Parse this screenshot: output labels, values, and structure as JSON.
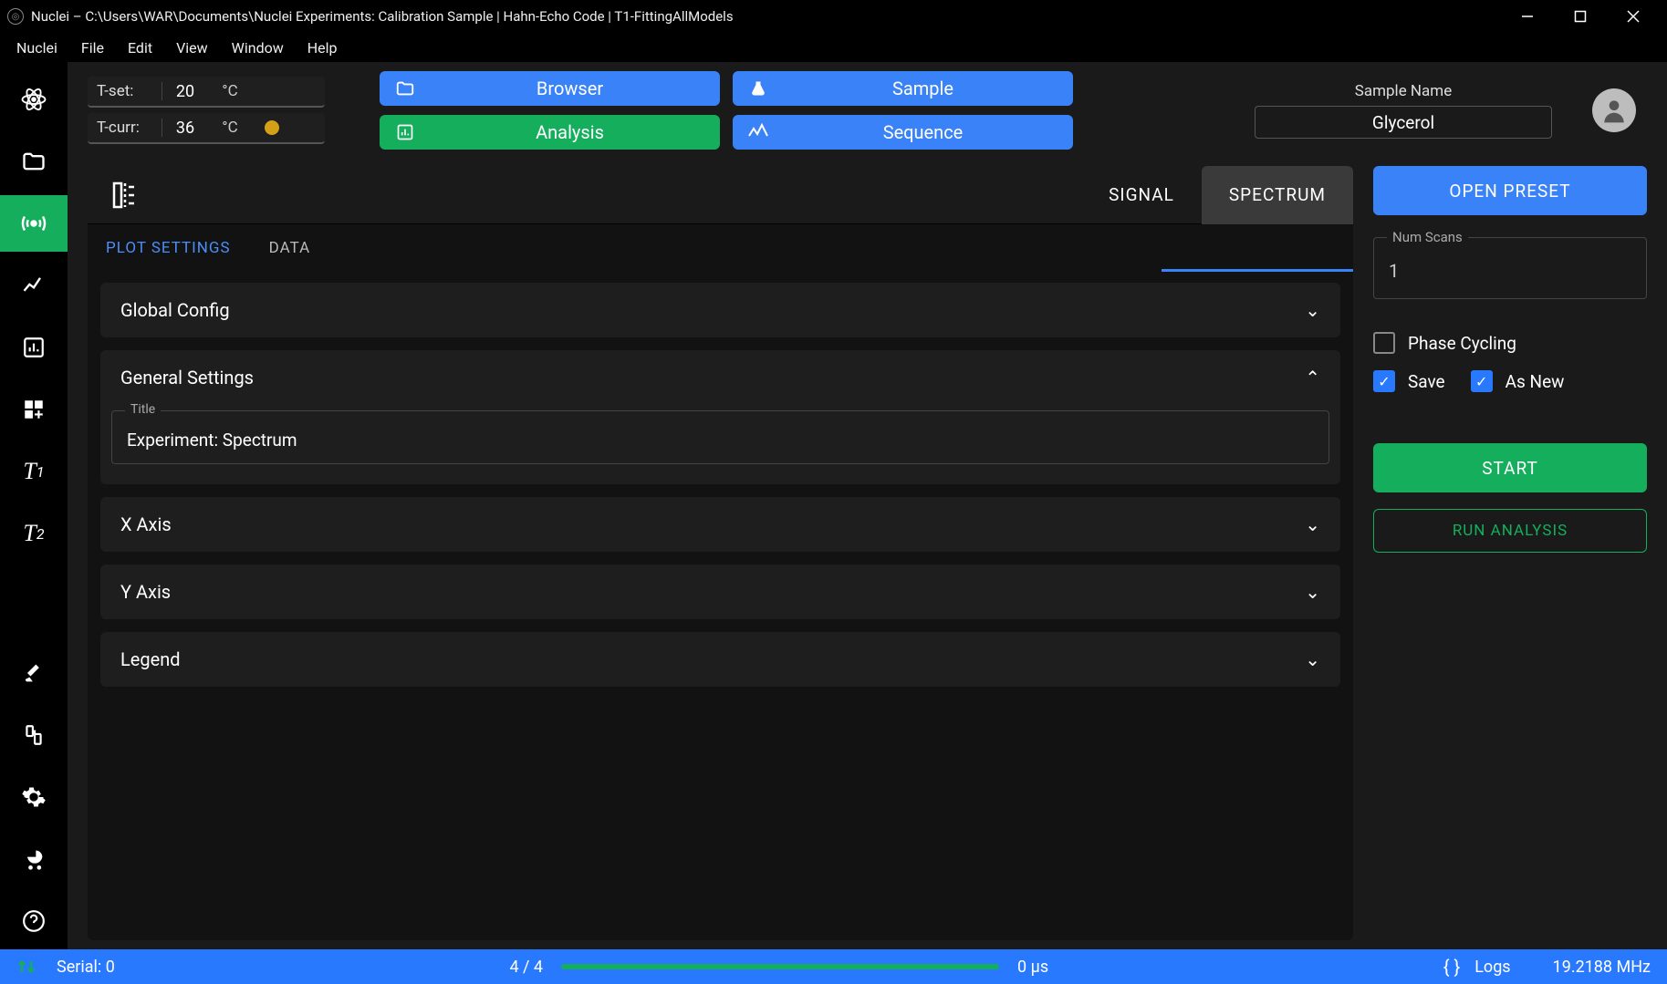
{
  "window": {
    "title": "Nuclei – C:\\Users\\WAR\\Documents\\Nuclei Experiments: Calibration Sample | Hahn-Echo Code | T1-FittingAllModels"
  },
  "menu": {
    "items": [
      "Nuclei",
      "File",
      "Edit",
      "View",
      "Window",
      "Help"
    ]
  },
  "rail": {
    "items": [
      {
        "name": "atom-icon",
        "glyph": "atom"
      },
      {
        "name": "folder-icon",
        "glyph": "folder"
      },
      {
        "name": "broadcast-icon",
        "glyph": "broadcast",
        "active": true
      },
      {
        "name": "line-chart-icon",
        "glyph": "line"
      },
      {
        "name": "bar-chart-icon",
        "glyph": "bar"
      },
      {
        "name": "widgets-icon",
        "glyph": "widgets"
      },
      {
        "name": "t1-icon",
        "glyph": "T1"
      },
      {
        "name": "t2-icon",
        "glyph": "T2"
      }
    ],
    "bottom": [
      {
        "name": "dig-icon",
        "glyph": "dig"
      },
      {
        "name": "device-icon",
        "glyph": "device"
      },
      {
        "name": "gear-icon",
        "glyph": "gear"
      },
      {
        "name": "stroller-icon",
        "glyph": "stroller"
      },
      {
        "name": "help-icon",
        "glyph": "help"
      }
    ]
  },
  "temp": {
    "set_label": "T-set:",
    "set_value": "20",
    "curr_label": "T-curr:",
    "curr_value": "36",
    "unit": "°C"
  },
  "nav": {
    "browser": "Browser",
    "sample": "Sample",
    "analysis": "Analysis",
    "sequence": "Sequence"
  },
  "sample": {
    "label": "Sample Name",
    "value": "Glycerol"
  },
  "center": {
    "signal": "SIGNAL",
    "spectrum": "SPECTRUM",
    "tabs": {
      "plot_settings": "PLOT SETTINGS",
      "data": "DATA"
    },
    "panels": {
      "global": "Global Config",
      "general": "General Settings",
      "title_label": "Title",
      "title_value": "Experiment: Spectrum",
      "xaxis": "X Axis",
      "yaxis": "Y Axis",
      "legend": "Legend"
    }
  },
  "right": {
    "open_preset": "OPEN PRESET",
    "num_scans_label": "Num Scans",
    "num_scans_value": "1",
    "phase_cycling": "Phase Cycling",
    "save": "Save",
    "as_new": "As New",
    "start": "START",
    "run_analysis": "RUN ANALYSIS"
  },
  "status": {
    "serial": "Serial: 0",
    "progress": "4 / 4",
    "time": "0 µs",
    "logs": "Logs",
    "freq": "19.2188 MHz"
  }
}
